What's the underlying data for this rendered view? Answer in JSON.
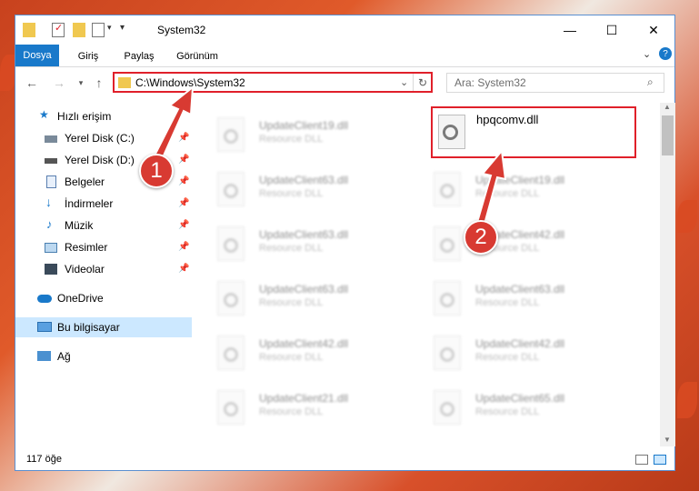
{
  "window": {
    "title": "System32"
  },
  "ribbon": {
    "tabs": [
      "Dosya",
      "Giriş",
      "Paylaş",
      "Görünüm"
    ]
  },
  "address": {
    "path": "C:\\Windows\\System32"
  },
  "search": {
    "placeholder": "Ara: System32"
  },
  "nav": {
    "quick_access": "Hızlı erişim",
    "items": [
      "Yerel Disk (C:)",
      "Yerel Disk (D:)",
      "Belgeler",
      "İndirmeler",
      "Müzik",
      "Resimler",
      "Videolar"
    ],
    "onedrive": "OneDrive",
    "this_pc": "Bu bilgisayar",
    "network": "Ağ"
  },
  "files": {
    "highlighted": {
      "name": "hpqcomv.dll"
    },
    "type_label": "Resource DLL",
    "left_column": [
      "UpdateClient19.dll",
      "UpdateClient63.dll",
      "UpdateClient63.dll",
      "UpdateClient63.dll",
      "UpdateClient42.dll",
      "UpdateClient21.dll"
    ],
    "right_column": [
      "UpdateClient19.dll",
      "UpdateClient42.dll",
      "UpdateClient63.dll",
      "UpdateClient42.dll",
      "UpdateClient65.dll"
    ]
  },
  "status": {
    "count": "117 öğe"
  },
  "annotations": {
    "one": "1",
    "two": "2"
  },
  "colors": {
    "accent": "#1979ca",
    "highlight": "#e0202a",
    "callout": "#d83a32",
    "selected_nav": "#cce8ff"
  }
}
